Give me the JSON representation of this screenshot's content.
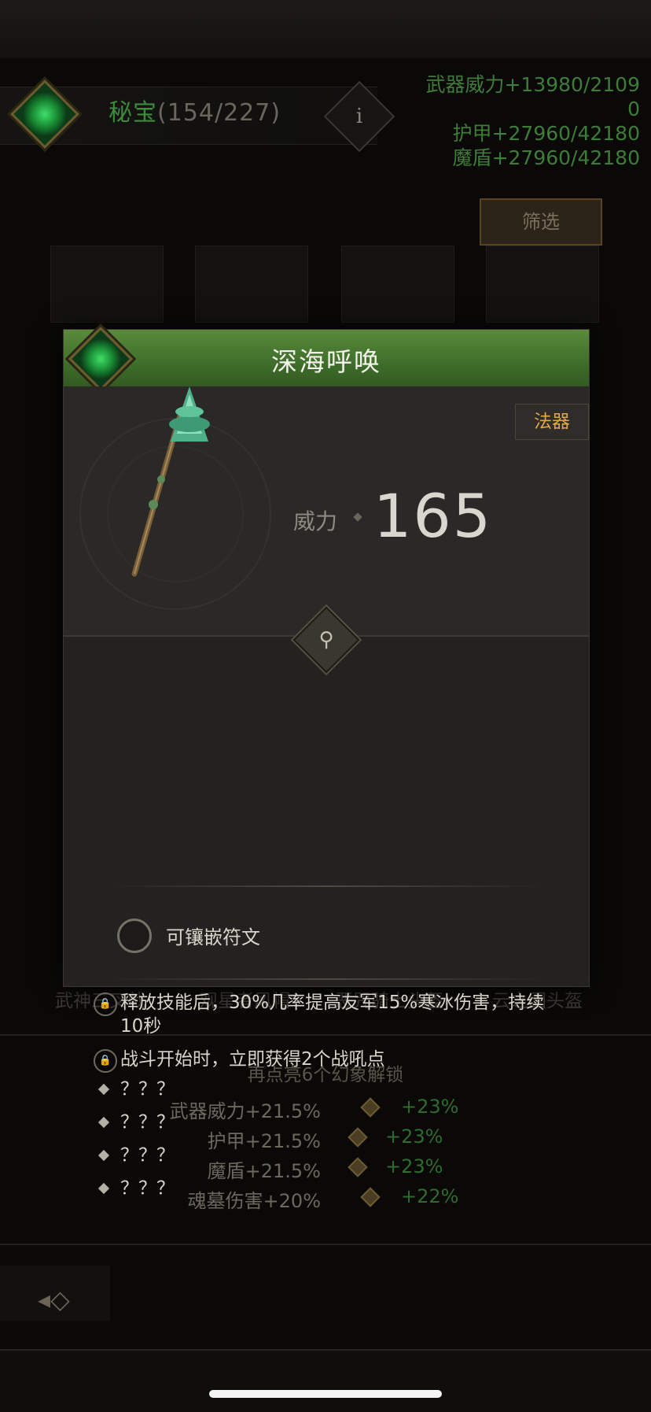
{
  "header": {
    "title": "秘宝",
    "count": "(154/227)",
    "info_icon": "i",
    "stats": [
      "武器威力+13980/2109",
      "0",
      "护甲+27960/42180",
      "魔盾+27960/42180"
    ]
  },
  "filter_label": "筛选",
  "collection_names": [
    "武神三叉戟",
    "观星者风帽",
    "恶咒骑士头盔",
    "云之国头盔"
  ],
  "unlock": {
    "title": "再点亮6个幻象解锁",
    "rows": [
      {
        "from": "武器威力+21.5%",
        "to": "+23%"
      },
      {
        "from": "护甲+21.5%",
        "to": "+23%"
      },
      {
        "from": "魔盾+21.5%",
        "to": "+23%"
      },
      {
        "from": "魂墓伤害+20%",
        "to": "+22%"
      }
    ]
  },
  "modal": {
    "title": "深海呼唤",
    "type_tag": "法器",
    "power_label": "威力",
    "power_value": "165",
    "effects": [
      {
        "locked": true,
        "text": "释放技能后，30%几率提高友军15%寒冰伤害，持续10秒"
      },
      {
        "locked": true,
        "text": "战斗开始时，立即获得2个战吼点"
      },
      {
        "locked": false,
        "text": "？？？"
      },
      {
        "locked": false,
        "text": "？？？"
      },
      {
        "locked": false,
        "text": "？？？"
      },
      {
        "locked": false,
        "text": "？？？"
      }
    ],
    "socket_label": "可镶嵌符文"
  },
  "colors": {
    "header_green": "#3e8a3c",
    "modal_header": "#4a7a32",
    "tag_orange": "#e3a54e",
    "unlock_green": "#2f6b2c"
  },
  "icons": [
    "emerald-gem-icon",
    "info-icon",
    "magnifier-icon",
    "lock-icon",
    "back-arrow-icon"
  ]
}
